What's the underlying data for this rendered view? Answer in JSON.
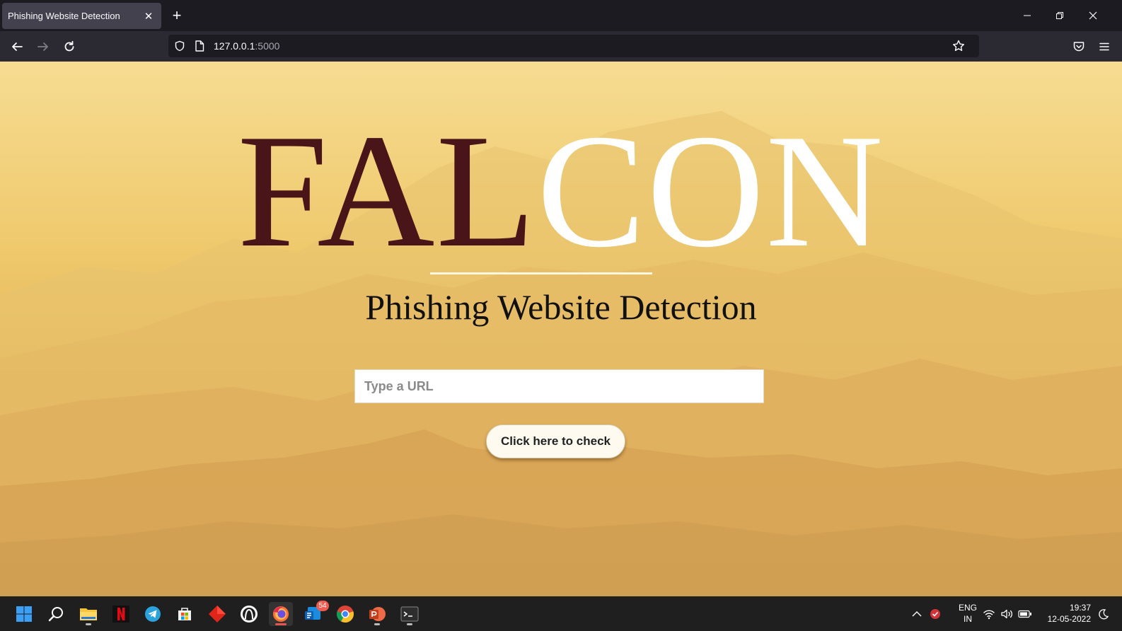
{
  "browser": {
    "tab": {
      "title": "Phishing Website Detection"
    },
    "url": {
      "host": "127.0.0.1",
      "port": ":5000"
    }
  },
  "page": {
    "logo": {
      "part1": "FAL",
      "part2": "CON"
    },
    "subtitle": "Phishing Website Detection",
    "input": {
      "placeholder": "Type a URL",
      "value": ""
    },
    "button": {
      "label": "Click here to check"
    },
    "colors": {
      "logo_dark": "#4a1518",
      "logo_light": "#ffffff",
      "background": "#efc96c"
    }
  },
  "taskbar": {
    "apps": [
      "windows-start-icon",
      "search-icon",
      "file-explorer-icon",
      "netflix-icon",
      "telegram-icon",
      "microsoft-store-icon",
      "red-app-icon",
      "linux-app-icon",
      "firefox-icon",
      "mail-icon",
      "chrome-icon",
      "powerpoint-icon",
      "terminal-icon"
    ],
    "mail_badge": "54",
    "language": {
      "line1": "ENG",
      "line2": "IN"
    },
    "clock": {
      "time": "19:37",
      "date": "12-05-2022"
    }
  }
}
